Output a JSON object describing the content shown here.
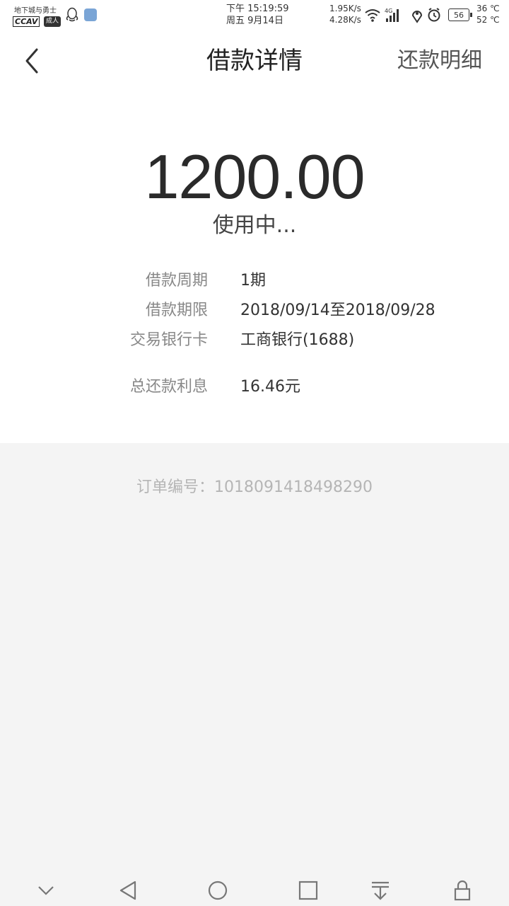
{
  "status_bar": {
    "logo_line1": "地下城与勇士",
    "logo_brand": "CCAV",
    "logo_badge": "成人",
    "time": "下午 15:19:59",
    "date": "周五 9月14日",
    "net_up": "1.95K/s",
    "net_down": "4.28K/s",
    "network_type": "4G",
    "battery": "56",
    "temp1": "36 ℃",
    "temp2": "52 ℃",
    "icons": [
      "qq-icon",
      "app-icon",
      "wifi-icon",
      "signal-icon",
      "location-icon",
      "alarm-icon",
      "battery-icon"
    ]
  },
  "header": {
    "title": "借款详情",
    "right_action": "还款明细",
    "back_icon": "chevron-left-icon"
  },
  "loan": {
    "amount": "1200.00",
    "status": "使用中...",
    "details": [
      {
        "label": "借款周期",
        "value": "1期"
      },
      {
        "label": "借款期限",
        "value": "2018/09/14至2018/09/28"
      },
      {
        "label": "交易银行卡",
        "value": "工商银行(1688)"
      }
    ],
    "interest_label": "总还款利息",
    "interest_value": "16.46元"
  },
  "order": {
    "text": "订单编号：1018091418498290"
  },
  "nav_bar": {
    "buttons": [
      "chevron-down-icon",
      "back-triangle-icon",
      "home-circle-icon",
      "recents-square-icon",
      "pull-down-icon",
      "lock-icon"
    ]
  },
  "colors": {
    "background": "#ffffff",
    "gray_area": "#f4f4f4",
    "label": "#888888",
    "value": "#333333",
    "muted": "#b5b5b5"
  }
}
